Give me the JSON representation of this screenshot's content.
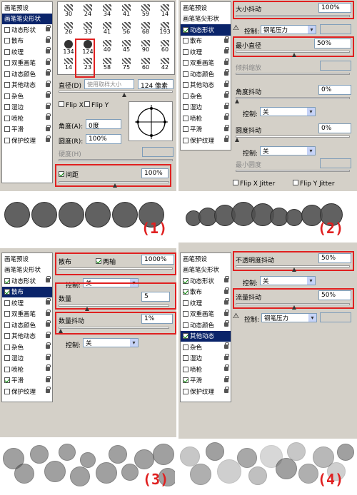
{
  "panel1": {
    "sidebar": [
      "画笔预设",
      "画笔笔尖形状",
      "动态形状",
      "散布",
      "纹理",
      "双重画笔",
      "动态颜色",
      "其他动态",
      "杂色",
      "湿边",
      "喷枪",
      "平滑",
      "保护纹理"
    ],
    "brushes": [
      "30",
      "24",
      "34",
      "41",
      "59",
      "14",
      "26",
      "33",
      "41",
      "56",
      "68",
      "193",
      "134",
      "124",
      "40",
      "45",
      "90",
      "60",
      "14",
      "23",
      "58",
      "75",
      "60",
      "42"
    ],
    "diameter_label": "直径(D)",
    "use_sample": "使用取样大小",
    "diameter_value": "124 像素",
    "flipx": "Flip X",
    "flipy": "Flip Y",
    "angle_label": "角度(A):",
    "angle_value": "0度",
    "roundness_label": "圆度(R):",
    "roundness_value": "100%",
    "hardness_label": "硬度(H)",
    "spacing_label": "间距",
    "spacing_value": "100%",
    "number": "(1)"
  },
  "panel2": {
    "sidebar": [
      "画笔预设",
      "画笔笔尖形状",
      "动态形状",
      "散布",
      "纹理",
      "双重画笔",
      "动态颜色",
      "其他动态",
      "杂色",
      "湿边",
      "喷枪",
      "平滑",
      "保护纹理"
    ],
    "size_jitter": "大小抖动",
    "size_jitter_value": "100%",
    "control_label": "控制:",
    "control_pen": "钢笔压力",
    "min_diameter": "最小直径",
    "min_diameter_value": "50%",
    "tilt_scale": "倾斜缩放",
    "angle_jitter": "角度抖动",
    "angle_jitter_value": "0%",
    "control_off": "关",
    "round_jitter": "圆度抖动",
    "round_jitter_value": "0%",
    "min_round": "最小圆度",
    "flipx": "Flip X Jitter",
    "flipy": "Flip Y Jitter",
    "number": "(2)"
  },
  "panel3": {
    "sidebar": [
      "画笔预设",
      "画笔笔尖形状",
      "动态形状",
      "散布",
      "纹理",
      "双重画笔",
      "动态颜色",
      "其他动态",
      "杂色",
      "湿边",
      "喷枪",
      "平滑",
      "保护纹理"
    ],
    "scatter": "散布",
    "both_axes": "两轴",
    "scatter_value": "1000%",
    "control_label": "控制:",
    "control_off": "关",
    "count": "数量",
    "count_value": "5",
    "count_jitter": "数量抖动",
    "count_jitter_value": "1%",
    "number": "(3)"
  },
  "panel4": {
    "sidebar": [
      "画笔预设",
      "画笔笔尖形状",
      "动态形状",
      "散布",
      "纹理",
      "双重画笔",
      "动态颜色",
      "其他动态",
      "杂色",
      "湿边",
      "喷枪",
      "平滑",
      "保护纹理"
    ],
    "opacity_jitter": "不透明度抖动",
    "opacity_jitter_value": "50%",
    "control_label": "控制:",
    "control_off": "关",
    "flow_jitter": "流量抖动",
    "flow_jitter_value": "50%",
    "control_pen": "钢笔压力",
    "number": "(4)"
  }
}
